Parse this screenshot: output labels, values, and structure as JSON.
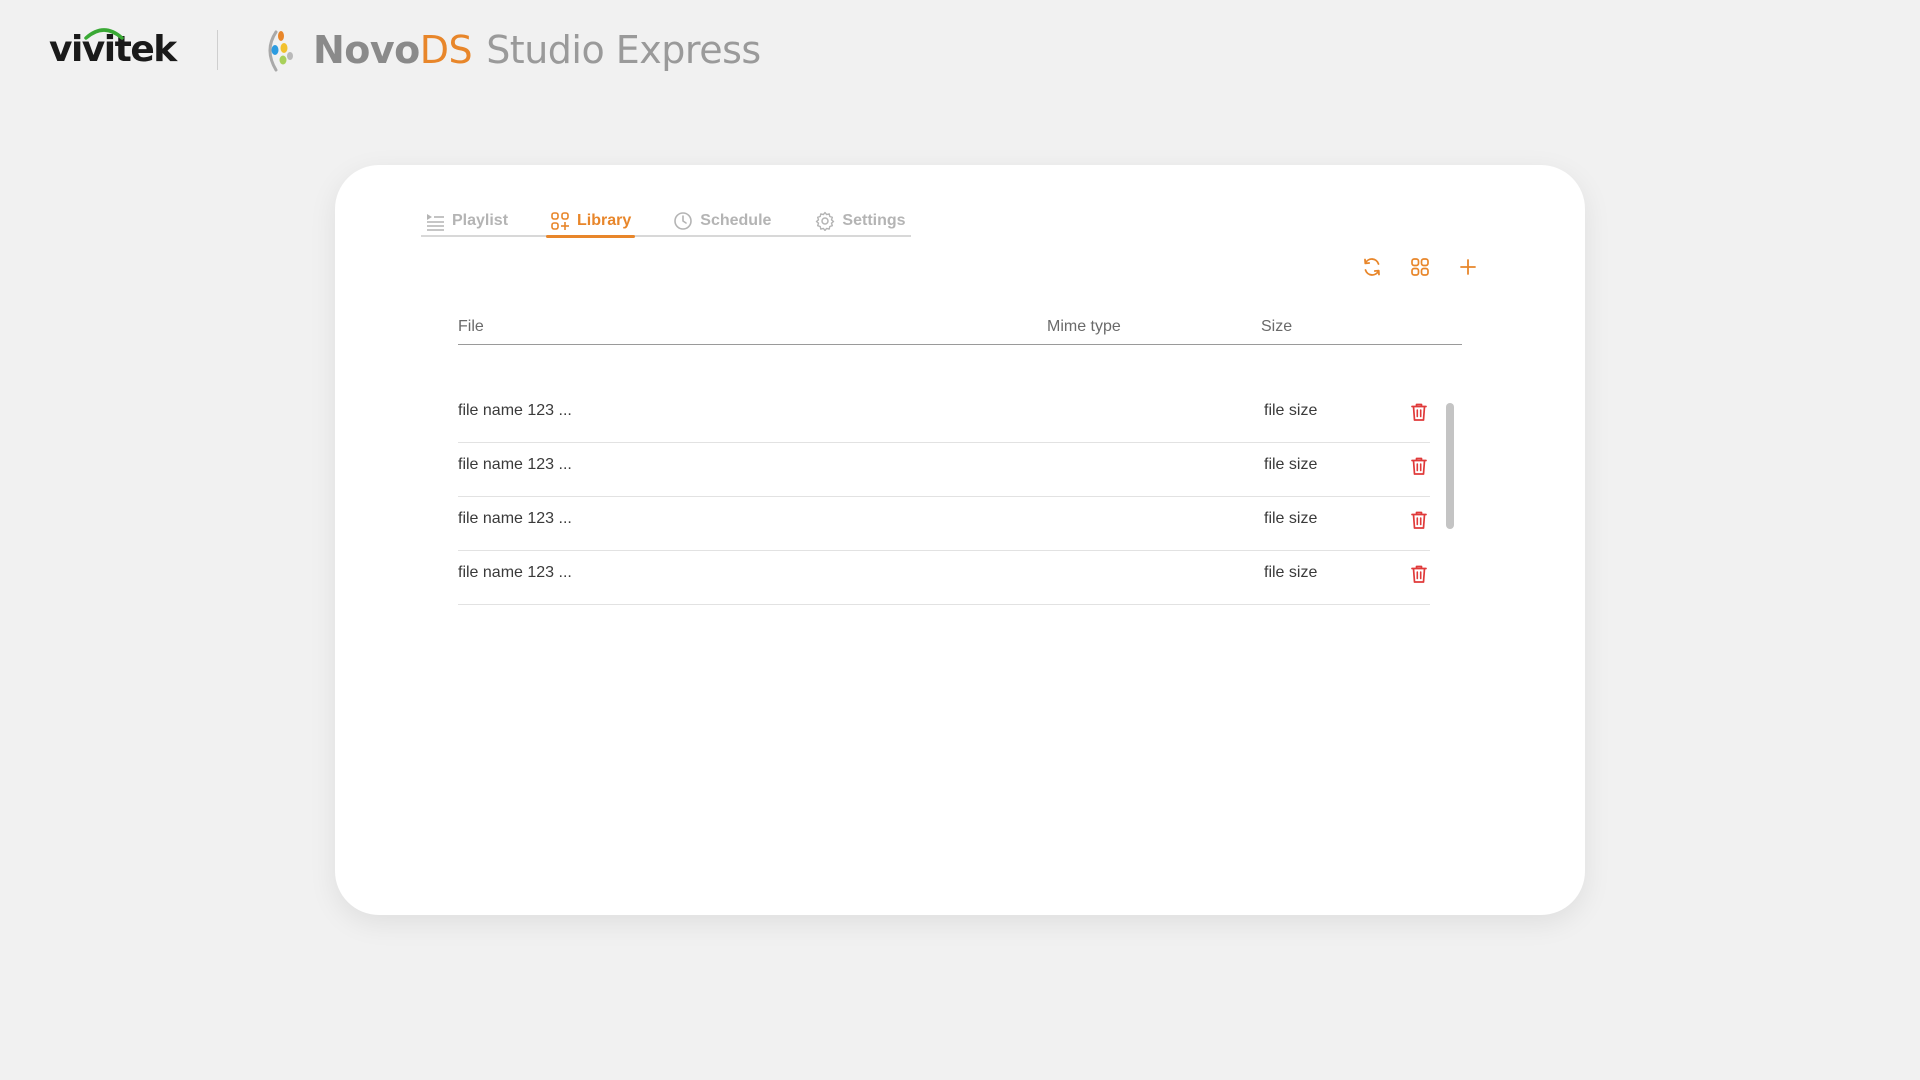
{
  "header": {
    "brand_logo": "vivitek",
    "product_prefix": "Novo",
    "product_accent": "DS",
    "product_suffix": "Studio Express"
  },
  "tabs": [
    {
      "label": "Playlist",
      "icon": "playlist-icon",
      "active": false
    },
    {
      "label": "Library",
      "icon": "library-icon",
      "active": true
    },
    {
      "label": "Schedule",
      "icon": "clock-icon",
      "active": false
    },
    {
      "label": "Settings",
      "icon": "gear-icon",
      "active": false
    }
  ],
  "toolbar": {
    "refresh_icon": "refresh-icon",
    "grid_view_icon": "grid-view-icon",
    "add_icon": "plus-icon"
  },
  "table": {
    "columns": [
      "File",
      "Mime type",
      "Size"
    ],
    "rows": [
      {
        "file": "file name 123 ...",
        "mime": "",
        "size": "file size"
      },
      {
        "file": "file name 123 ...",
        "mime": "",
        "size": "file size"
      },
      {
        "file": "file name 123 ...",
        "mime": "",
        "size": "file size"
      },
      {
        "file": "file name 123 ...",
        "mime": "",
        "size": "file size"
      }
    ]
  },
  "colors": {
    "accent": "#e8862a",
    "delete": "#e03a3a",
    "background": "#f1f1f1",
    "card": "#ffffff"
  }
}
